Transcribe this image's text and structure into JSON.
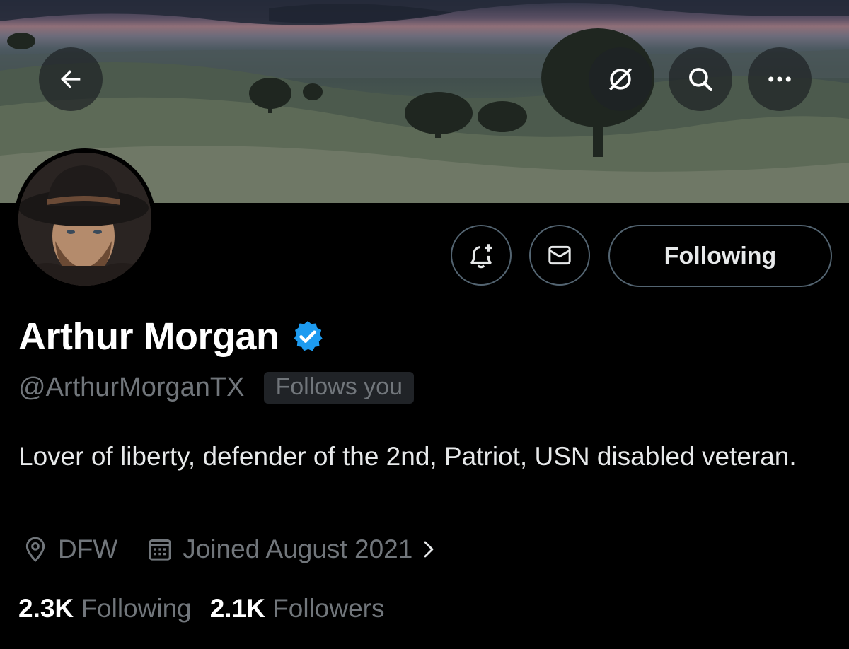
{
  "header": {
    "back_icon": "arrow-left-icon",
    "grok_icon": "grok-icon",
    "search_icon": "search-icon",
    "more_icon": "more-horizontal-icon"
  },
  "profile": {
    "display_name": "Arthur Morgan",
    "verified": true,
    "verified_color": "#1d9bf0",
    "handle": "@ArthurMorganTX",
    "follows_you_label": "Follows you",
    "bio": "Lover of liberty, defender of the 2nd, Patriot, USN disabled veteran.",
    "location": "DFW",
    "joined": "Joined August 2021",
    "following_count": "2.3K",
    "following_label": "Following",
    "followers_count": "2.1K",
    "followers_label": "Followers"
  },
  "actions": {
    "notify_icon": "bell-plus-icon",
    "message_icon": "envelope-icon",
    "following_button_label": "Following"
  },
  "colors": {
    "background": "#000000",
    "text_primary": "#e7e9ea",
    "text_secondary": "#71767b",
    "border": "#536471",
    "badge_bg": "#202327"
  }
}
